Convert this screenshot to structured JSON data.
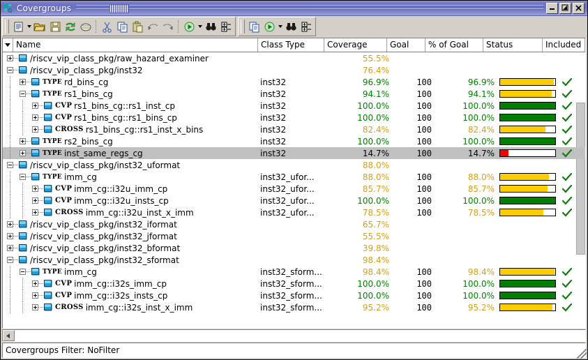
{
  "window": {
    "title": "Covergroups",
    "icon": "covergroup-icon",
    "buttons": [
      {
        "name": "minimize-button",
        "glyph": "—"
      },
      {
        "name": "restore-button",
        "glyph": "❐"
      },
      {
        "name": "close-button",
        "glyph": "✕"
      }
    ]
  },
  "toolbar": {
    "group1": [
      {
        "name": "new-document-button",
        "icon": "document-icon",
        "dropdown": true
      },
      {
        "name": "open-folder-button",
        "icon": "open-folder-icon"
      },
      {
        "name": "save-button",
        "icon": "save-disk-icon"
      },
      {
        "name": "refresh-button",
        "icon": "refresh-arrows-icon"
      },
      {
        "name": "print-button",
        "icon": "printer-icon"
      },
      {
        "name": "cut-button",
        "icon": "scissors-icon"
      },
      {
        "name": "copy-button",
        "icon": "copy-pages-icon"
      },
      {
        "name": "paste-button",
        "icon": "paste-clipboard-icon"
      },
      {
        "name": "undo-button",
        "icon": "undo-arrow-icon"
      },
      {
        "name": "redo-button",
        "icon": "redo-arrow-icon"
      },
      {
        "name": "run-button",
        "icon": "green-circle-play-icon",
        "dropdown": true
      },
      {
        "name": "find-button",
        "icon": "binoculars-icon"
      },
      {
        "name": "expand-all-button",
        "icon": "expand-tree-icon"
      }
    ],
    "group2": [
      {
        "name": "copy-button-2",
        "icon": "copy-pages-icon"
      },
      {
        "name": "run-button-2",
        "icon": "green-circle-play-icon",
        "dropdown": true
      },
      {
        "name": "find-button-2",
        "icon": "binoculars-icon"
      },
      {
        "name": "expand-all-button-2",
        "icon": "expand-tree-icon"
      }
    ]
  },
  "grid": {
    "columns": [
      {
        "key": "name",
        "label": "Name"
      },
      {
        "key": "class_type",
        "label": "Class Type"
      },
      {
        "key": "coverage",
        "label": "Coverage"
      },
      {
        "key": "goal",
        "label": "Goal"
      },
      {
        "key": "pct_of_goal",
        "label": "% of Goal"
      },
      {
        "key": "status",
        "label": "Status"
      },
      {
        "key": "included",
        "label": "Included"
      }
    ],
    "rows": [
      {
        "indent": 0,
        "twisty": "plus",
        "kw": "",
        "name": "/riscv_vip_class_pkg/raw_hazard_examiner",
        "class_type": "",
        "coverage": "55.5%",
        "cov_color": "gold",
        "goal": "",
        "pct": "",
        "pct_color": "gold",
        "bar": null,
        "included": false,
        "selected": false
      },
      {
        "indent": 0,
        "twisty": "minus",
        "kw": "",
        "name": "/riscv_vip_class_pkg/inst32",
        "class_type": "",
        "coverage": "76.4%",
        "cov_color": "gold",
        "goal": "",
        "pct": "",
        "pct_color": "gold",
        "bar": null,
        "included": false,
        "selected": false
      },
      {
        "indent": 1,
        "twisty": "plus",
        "kw": "TYPE",
        "name": "rd_bins_cg",
        "class_type": "inst32",
        "coverage": "96.9%",
        "cov_color": "green",
        "goal": "100",
        "pct": "96.9%",
        "pct_color": "green",
        "bar": {
          "pct": 96.9,
          "color": "#ffcc00"
        },
        "included": true,
        "selected": false
      },
      {
        "indent": 1,
        "twisty": "minus",
        "kw": "TYPE",
        "name": "rs1_bins_cg",
        "class_type": "inst32",
        "coverage": "94.1%",
        "cov_color": "green",
        "goal": "100",
        "pct": "94.1%",
        "pct_color": "green",
        "bar": {
          "pct": 94.1,
          "color": "#ffcc00"
        },
        "included": true,
        "selected": false
      },
      {
        "indent": 2,
        "twisty": "plus",
        "kw": "CVP",
        "name": "rs1_bins_cg::rs1_inst_cp",
        "class_type": "inst32",
        "coverage": "100.0%",
        "cov_color": "green",
        "goal": "100",
        "pct": "100.0%",
        "pct_color": "green",
        "bar": {
          "pct": 100,
          "color": "#008000"
        },
        "included": true,
        "selected": false
      },
      {
        "indent": 2,
        "twisty": "plus",
        "kw": "CVP",
        "name": "rs1_bins_cg::rs1_bins_cp",
        "class_type": "inst32",
        "coverage": "100.0%",
        "cov_color": "green",
        "goal": "100",
        "pct": "100.0%",
        "pct_color": "green",
        "bar": {
          "pct": 100,
          "color": "#008000"
        },
        "included": true,
        "selected": false
      },
      {
        "indent": 2,
        "twisty": "plus",
        "kw": "CROSS",
        "name": "rs1_bins_cg::rs1_inst_x_bins",
        "class_type": "inst32",
        "coverage": "82.4%",
        "cov_color": "gold",
        "goal": "100",
        "pct": "82.4%",
        "pct_color": "gold",
        "bar": {
          "pct": 82.4,
          "color": "#ffcc00"
        },
        "included": true,
        "selected": false
      },
      {
        "indent": 1,
        "twisty": "plus",
        "kw": "TYPE",
        "name": "rs2_bins_cg",
        "class_type": "inst32",
        "coverage": "100.0%",
        "cov_color": "green",
        "goal": "100",
        "pct": "100.0%",
        "pct_color": "green",
        "bar": {
          "pct": 100,
          "color": "#008000"
        },
        "included": true,
        "selected": false
      },
      {
        "indent": 1,
        "twisty": "plus",
        "kw": "TYPE",
        "name": "inst_same_regs_cg",
        "class_type": "inst32",
        "coverage": "14.7%",
        "cov_color": "black",
        "goal": "100",
        "pct": "14.7%",
        "pct_color": "black",
        "bar": {
          "pct": 14.7,
          "color": "#ff0000"
        },
        "included": true,
        "selected": true
      },
      {
        "indent": 0,
        "twisty": "minus",
        "kw": "",
        "name": "/riscv_vip_class_pkg/inst32_uformat",
        "class_type": "",
        "coverage": "88.0%",
        "cov_color": "gold",
        "goal": "",
        "pct": "",
        "pct_color": "gold",
        "bar": null,
        "included": false,
        "selected": false
      },
      {
        "indent": 1,
        "twisty": "minus",
        "kw": "TYPE",
        "name": "imm_cg",
        "class_type": "inst32_ufor...",
        "coverage": "88.0%",
        "cov_color": "gold",
        "goal": "100",
        "pct": "88.0%",
        "pct_color": "gold",
        "bar": {
          "pct": 88.0,
          "color": "#ffcc00"
        },
        "included": true,
        "selected": false
      },
      {
        "indent": 2,
        "twisty": "plus",
        "kw": "CVP",
        "name": "imm_cg::i32u_imm_cp",
        "class_type": "inst32_ufor...",
        "coverage": "85.7%",
        "cov_color": "gold",
        "goal": "100",
        "pct": "85.7%",
        "pct_color": "gold",
        "bar": {
          "pct": 85.7,
          "color": "#ffcc00"
        },
        "included": true,
        "selected": false
      },
      {
        "indent": 2,
        "twisty": "plus",
        "kw": "CVP",
        "name": "imm_cg::i32u_insts_cp",
        "class_type": "inst32_ufor...",
        "coverage": "100.0%",
        "cov_color": "green",
        "goal": "100",
        "pct": "100.0%",
        "pct_color": "green",
        "bar": {
          "pct": 100,
          "color": "#008000"
        },
        "included": true,
        "selected": false
      },
      {
        "indent": 2,
        "twisty": "plus",
        "kw": "CROSS",
        "name": "imm_cg::i32u_inst_x_imm",
        "class_type": "inst32_ufor...",
        "coverage": "78.5%",
        "cov_color": "gold",
        "goal": "100",
        "pct": "78.5%",
        "pct_color": "gold",
        "bar": {
          "pct": 78.5,
          "color": "#ffcc00"
        },
        "included": true,
        "selected": false
      },
      {
        "indent": 0,
        "twisty": "plus",
        "kw": "",
        "name": "/riscv_vip_class_pkg/inst32_iformat",
        "class_type": "",
        "coverage": "65.7%",
        "cov_color": "gold",
        "goal": "",
        "pct": "",
        "pct_color": "gold",
        "bar": null,
        "included": false,
        "selected": false
      },
      {
        "indent": 0,
        "twisty": "plus",
        "kw": "",
        "name": "/riscv_vip_class_pkg/inst32_jformat",
        "class_type": "",
        "coverage": "55.5%",
        "cov_color": "gold",
        "goal": "",
        "pct": "",
        "pct_color": "gold",
        "bar": null,
        "included": false,
        "selected": false
      },
      {
        "indent": 0,
        "twisty": "plus",
        "kw": "",
        "name": "/riscv_vip_class_pkg/inst32_bformat",
        "class_type": "",
        "coverage": "39.8%",
        "cov_color": "gold",
        "goal": "",
        "pct": "",
        "pct_color": "gold",
        "bar": null,
        "included": false,
        "selected": false
      },
      {
        "indent": 0,
        "twisty": "minus",
        "kw": "",
        "name": "/riscv_vip_class_pkg/inst32_sformat",
        "class_type": "",
        "coverage": "98.4%",
        "cov_color": "gold",
        "goal": "",
        "pct": "",
        "pct_color": "gold",
        "bar": null,
        "included": false,
        "selected": false
      },
      {
        "indent": 1,
        "twisty": "minus",
        "kw": "TYPE",
        "name": "imm_cg",
        "class_type": "inst32_sform...",
        "coverage": "98.4%",
        "cov_color": "gold",
        "goal": "100",
        "pct": "98.4%",
        "pct_color": "gold",
        "bar": {
          "pct": 98.4,
          "color": "#ffcc00"
        },
        "included": true,
        "selected": false
      },
      {
        "indent": 2,
        "twisty": "plus",
        "kw": "CVP",
        "name": "imm_cg::i32s_imm_cp",
        "class_type": "inst32_sform...",
        "coverage": "100.0%",
        "cov_color": "green",
        "goal": "100",
        "pct": "100.0%",
        "pct_color": "green",
        "bar": {
          "pct": 100,
          "color": "#008000"
        },
        "included": true,
        "selected": false
      },
      {
        "indent": 2,
        "twisty": "plus",
        "kw": "CVP",
        "name": "imm_cg::i32s_insts_cp",
        "class_type": "inst32_sform...",
        "coverage": "100.0%",
        "cov_color": "green",
        "goal": "100",
        "pct": "100.0%",
        "pct_color": "green",
        "bar": {
          "pct": 100,
          "color": "#008000"
        },
        "included": true,
        "selected": false
      },
      {
        "indent": 2,
        "twisty": "plus",
        "kw": "CROSS",
        "name": "imm_cg::i32s_inst_x_imm",
        "class_type": "inst32_sform...",
        "coverage": "95.2%",
        "cov_color": "gold",
        "goal": "100",
        "pct": "95.2%",
        "pct_color": "gold",
        "bar": {
          "pct": 95.2,
          "color": "#ffcc00"
        },
        "included": true,
        "selected": false
      }
    ]
  },
  "status": {
    "text": "Covergroups Filter: NoFilter"
  },
  "colors": {
    "title_bar": "#6a70bf",
    "coverage_green": "#008000",
    "coverage_gold": "#d4a017",
    "bar_yellow": "#ffcc00",
    "bar_green": "#008000",
    "bar_red": "#ff0000",
    "selection": "#c0c0c0",
    "chrome": "#d4d0c8"
  }
}
